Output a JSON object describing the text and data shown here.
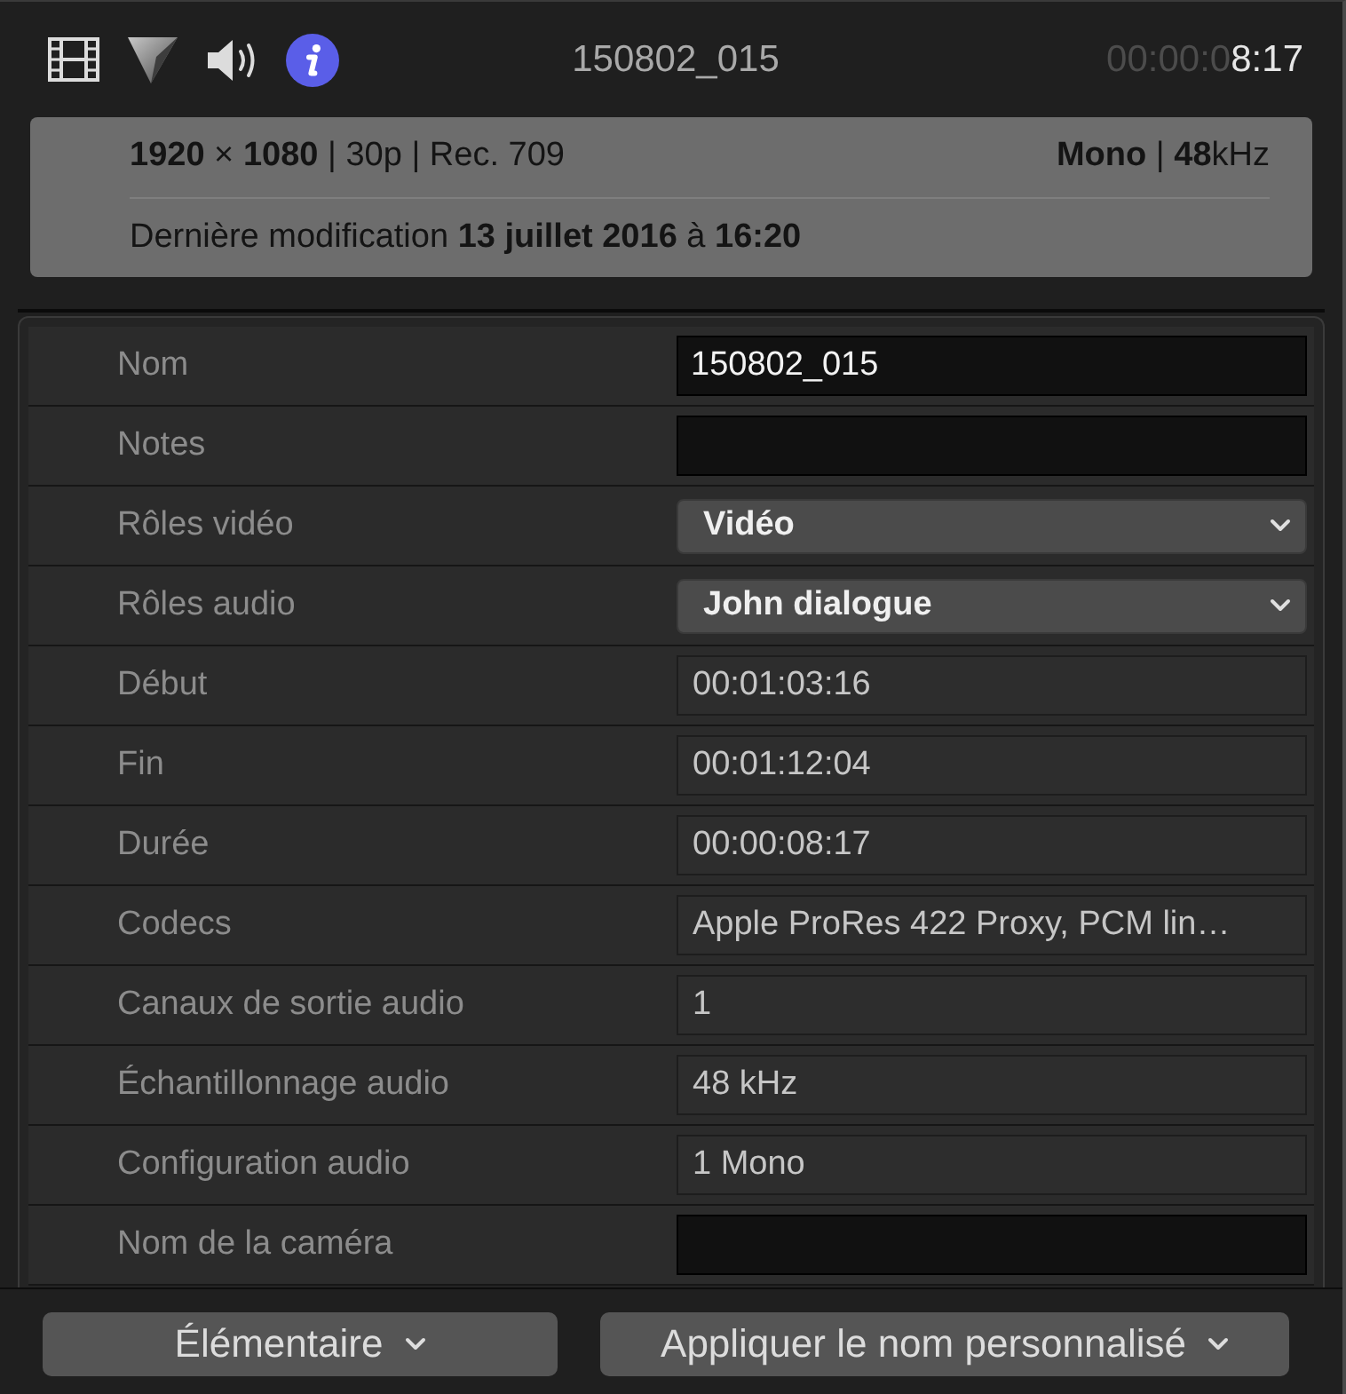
{
  "toolbar": {
    "tabs": [
      {
        "kind": "video",
        "selected": false
      },
      {
        "kind": "color",
        "selected": false
      },
      {
        "kind": "audio",
        "selected": false
      },
      {
        "kind": "info",
        "selected": true
      }
    ],
    "title": "150802_015",
    "timecode": {
      "unused": "00:00:0",
      "used": "8:17"
    }
  },
  "summary": {
    "format": "**1920** × **1080** | 30p | Rec. 709",
    "audio": "**Mono** | **48**kHz",
    "modified": "Dernière modification **13 juillet 2016** à **16:20**"
  },
  "properties": [
    {
      "label": "Nom",
      "kind": "text",
      "value": "150802_015"
    },
    {
      "label": "Notes",
      "kind": "text"
    },
    {
      "label": "Rôles vidéo",
      "kind": "dropdown",
      "value": "Vidéo"
    },
    {
      "label": "Rôles audio",
      "kind": "dropdown",
      "value": "John dialogue"
    },
    {
      "label": "Début",
      "kind": "readonly",
      "value": "00:01:03:16"
    },
    {
      "label": "Fin",
      "kind": "readonly",
      "value": "00:01:12:04"
    },
    {
      "label": "Durée",
      "kind": "readonly",
      "value": "00:00:08:17"
    },
    {
      "label": "Codecs",
      "kind": "readonly",
      "value": "Apple ProRes 422 Proxy, PCM lin…"
    },
    {
      "label": "Canaux de sortie audio",
      "kind": "readonly",
      "value": "1"
    },
    {
      "label": "Échantillonnage audio",
      "kind": "readonly",
      "value": "48 kHz"
    },
    {
      "label": "Configuration audio",
      "kind": "readonly",
      "value": "1 Mono"
    },
    {
      "label": "Nom de la caméra",
      "kind": "text"
    }
  ],
  "buttons": [
    {
      "label": "Élémentaire"
    },
    {
      "label": "Appliquer le nom personnalisé"
    }
  ]
}
